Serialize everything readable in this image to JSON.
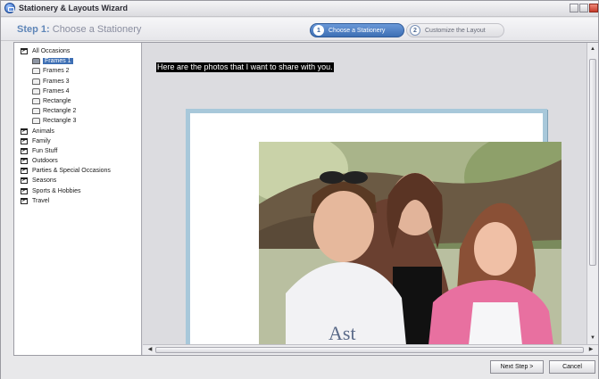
{
  "window": {
    "title": "Stationery & Layouts Wizard"
  },
  "step": {
    "prefix": "Step 1:",
    "title": " Choose a Stationery"
  },
  "steps": [
    {
      "num": "1",
      "label": "Choose a Stationery",
      "active": true
    },
    {
      "num": "2",
      "label": "Customize the Layout",
      "active": false
    }
  ],
  "tree": {
    "root": "All Occasions",
    "children": [
      "Frames 1",
      "Frames 2",
      "Frames 3",
      "Frames 4",
      "Rectangle",
      "Rectangle 2",
      "Rectangle 3"
    ],
    "selected_child": "Frames 1",
    "categories": [
      "Animals",
      "Family",
      "Fun Stuff",
      "Outdoors",
      "Parties & Special Occasions",
      "Seasons",
      "Sports & Hobbies",
      "Travel"
    ]
  },
  "preview": {
    "caption": "Here are the photos that I want to share with you."
  },
  "buttons": {
    "next": "Next Step >",
    "cancel": "Cancel"
  },
  "colors": {
    "accent": "#3d6fb4",
    "frame_border": "#a8c8da"
  }
}
